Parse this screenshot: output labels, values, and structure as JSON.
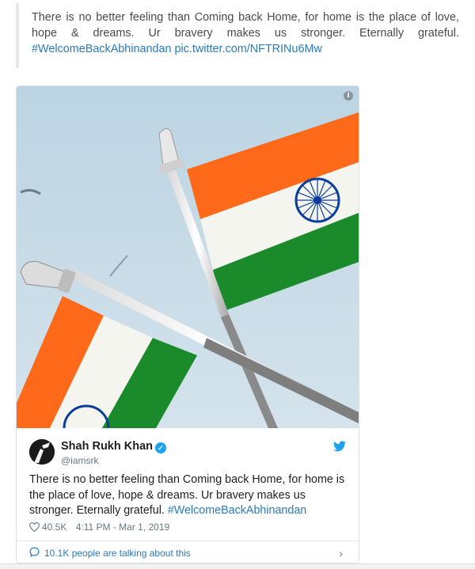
{
  "quote": {
    "text": "There is no better feeling than Coming back Home, for home is the place of love, hope & dreams. Ur bravery makes us stronger. Eternally grateful.",
    "hashtag": "#WelcomeBackAbhinandan",
    "link": "pic.twitter.com/NFTRINu6Mw"
  },
  "tweet": {
    "author_name": "Shah Rukh Khan",
    "handle": "@iamsrk",
    "text": "There is no better feeling than Coming back Home, for home is the place of love, hope & dreams. Ur bravery makes us stronger. Eternally grateful.",
    "hashtag": "#WelcomeBackAbhinandan",
    "likes": "40.5K",
    "timestamp": "4:11 PM - Mar 1, 2019",
    "talking": "10.1K people are talking about this",
    "info_glyph": "i"
  },
  "colors": {
    "link": "#2b7bb9",
    "twitter_blue": "#1da1f2",
    "saffron": "#ff6a1a",
    "flag_green": "#138808",
    "chakra": "#0b3d9a",
    "sky": "#c6dae6"
  },
  "icons": [
    "info-icon",
    "verified-icon",
    "twitter-bird-icon",
    "heart-icon",
    "chat-bubble-icon",
    "chevron-right-icon"
  ]
}
